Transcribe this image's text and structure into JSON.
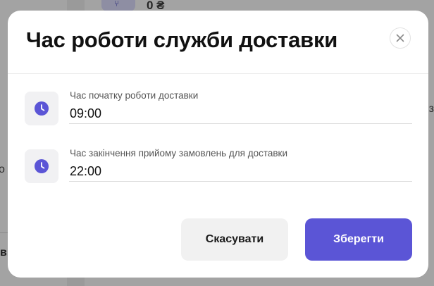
{
  "background": {
    "price_text": "0 ₴",
    "right_edge_text": "з",
    "left_edge_text": "о",
    "left_bold_text": "в."
  },
  "modal": {
    "title": "Час роботи служби доставки",
    "close_icon": "close-icon",
    "fields": [
      {
        "icon": "clock-icon",
        "label": "Час початку роботи доставки",
        "value": "09:00"
      },
      {
        "icon": "clock-icon",
        "label": "Час закінчення прийому замовлень для доставки",
        "value": "22:00"
      }
    ],
    "cancel_label": "Скасувати",
    "save_label": "Зберегти"
  },
  "colors": {
    "accent": "#5b55d6",
    "icon_box_bg": "#f1f1f3",
    "cancel_bg": "#f1f1f1",
    "overlay": "#a3a3a3"
  }
}
